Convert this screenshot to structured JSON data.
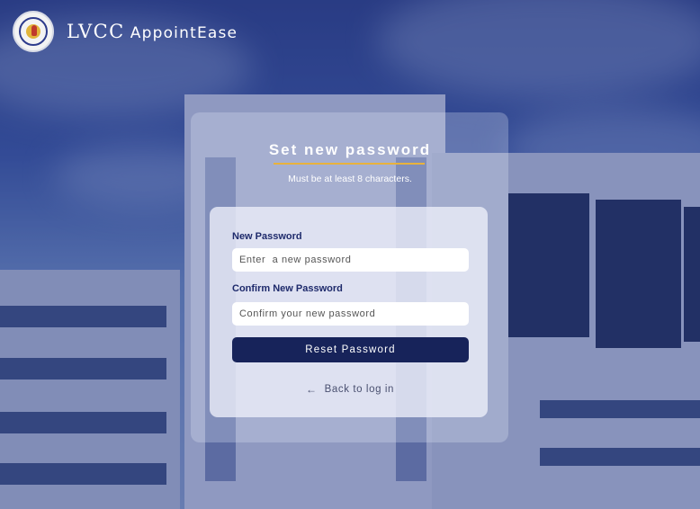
{
  "brand": {
    "prefix": "LVCC",
    "name": "AppointEase"
  },
  "form": {
    "heading": "Set new password",
    "subtitle": "Must be at least 8 characters.",
    "new_password_label": "New Password",
    "new_password_placeholder": "Enter  a new password",
    "confirm_password_label": "Confirm New Password",
    "confirm_password_placeholder": "Confirm your new password",
    "submit_label": "Reset Password",
    "back_label": "Back to log in"
  },
  "icons": {
    "logo": "seal-logo",
    "back": "arrow-left-icon"
  },
  "colors": {
    "primary": "#17235a",
    "accent": "#e8b23c",
    "label": "#1e2a6b"
  }
}
